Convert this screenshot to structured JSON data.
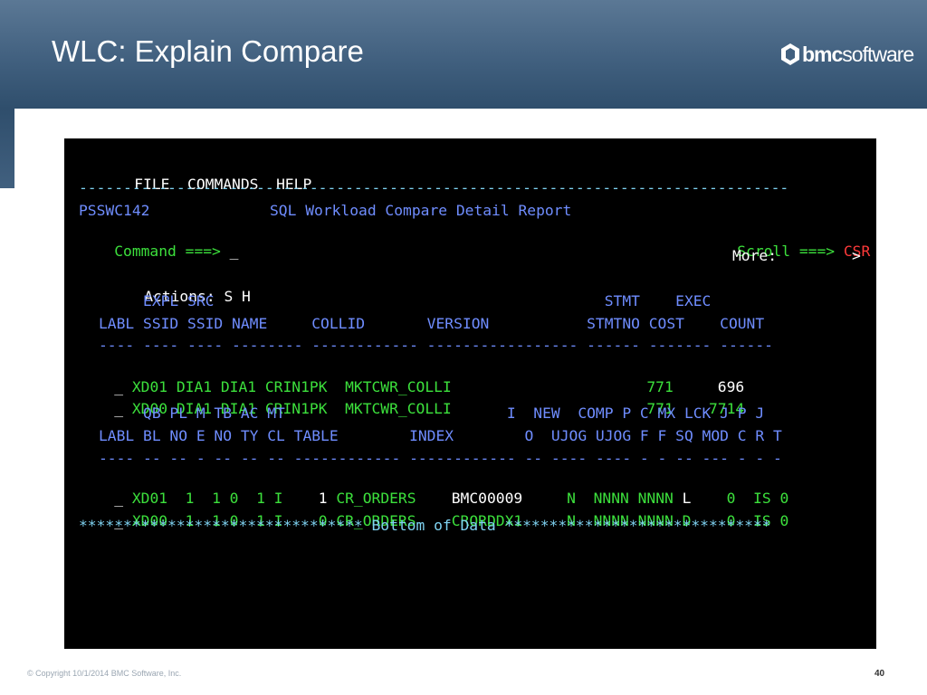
{
  "slide": {
    "title": "WLC: Explain Compare",
    "footer_copyright": "© Copyright 10/1/2014 BMC Software, Inc.",
    "page_number": "40"
  },
  "logo": {
    "bold": "bmc",
    "light": "software"
  },
  "terminal": {
    "menu": {
      "file": "FILE",
      "commands": "COMMANDS",
      "help": "HELP"
    },
    "separator": "--------------------------------------------------------------------------------",
    "panel_id": "PSSWC142",
    "report_title": "SQL Workload Compare Detail Report",
    "command_label": "Command ===>",
    "command_value": "_",
    "scroll_label": "Scroll ===>",
    "scroll_value": "CSR",
    "more_label": "More:",
    "more_arrow": ">",
    "actions_label": "Actions:",
    "actions_value": "S H",
    "table1": {
      "header1": "     EXPL SRC                                            STMT    EXEC",
      "header2": "LABL SSID SSID NAME     COLLID       VERSION           STMTNO COST    COUNT",
      "dashes": "---- ---- ---- -------- ------------ ----------------- ------ ------- ------",
      "rows": [
        {
          "sel": "_",
          "text": "XD01 DIA1 DIA1 CRIN1PK  MKTCWR_COLLI                      771",
          "cost": "     696"
        },
        {
          "sel": "_",
          "text": "XD00 DIA1 DIA1 CRIN1PK  MKTCWR_COLLI                      771",
          "cost": "    7714"
        }
      ]
    },
    "table2": {
      "header1": "     QB PL M TB AC MT                         I  NEW  COMP P C MX LCK J P J",
      "header2": "LABL BL NO E NO TY CL TABLE        INDEX        O  UJOG UJOG F F SQ MOD C R T",
      "dashes": "---- -- -- - -- -- -- ------------ ------------ -- ---- ---- - - -- --- - - -",
      "rows": [
        {
          "sel": "_",
          "p1": "XD01  1  1 0  1 I  ",
          "mt": "  1",
          "p2": " CR_ORDERS    ",
          "index": "BMC00009",
          "p3": "     N  NNNN NNNN ",
          "pf": "L",
          "p4": "    0  IS 0"
        },
        {
          "sel": "_",
          "p1": "XD00  1  1 0  1 I  ",
          "mt": "  0",
          "p2": " CR_ORDERS    ",
          "index": "CRORDDX1",
          "p3": "     N  NNNN NNNN ",
          "pf": "D",
          "p4": "    0  IS 0"
        }
      ]
    },
    "bottom": "******************************** Bottom of Data ******************************"
  }
}
